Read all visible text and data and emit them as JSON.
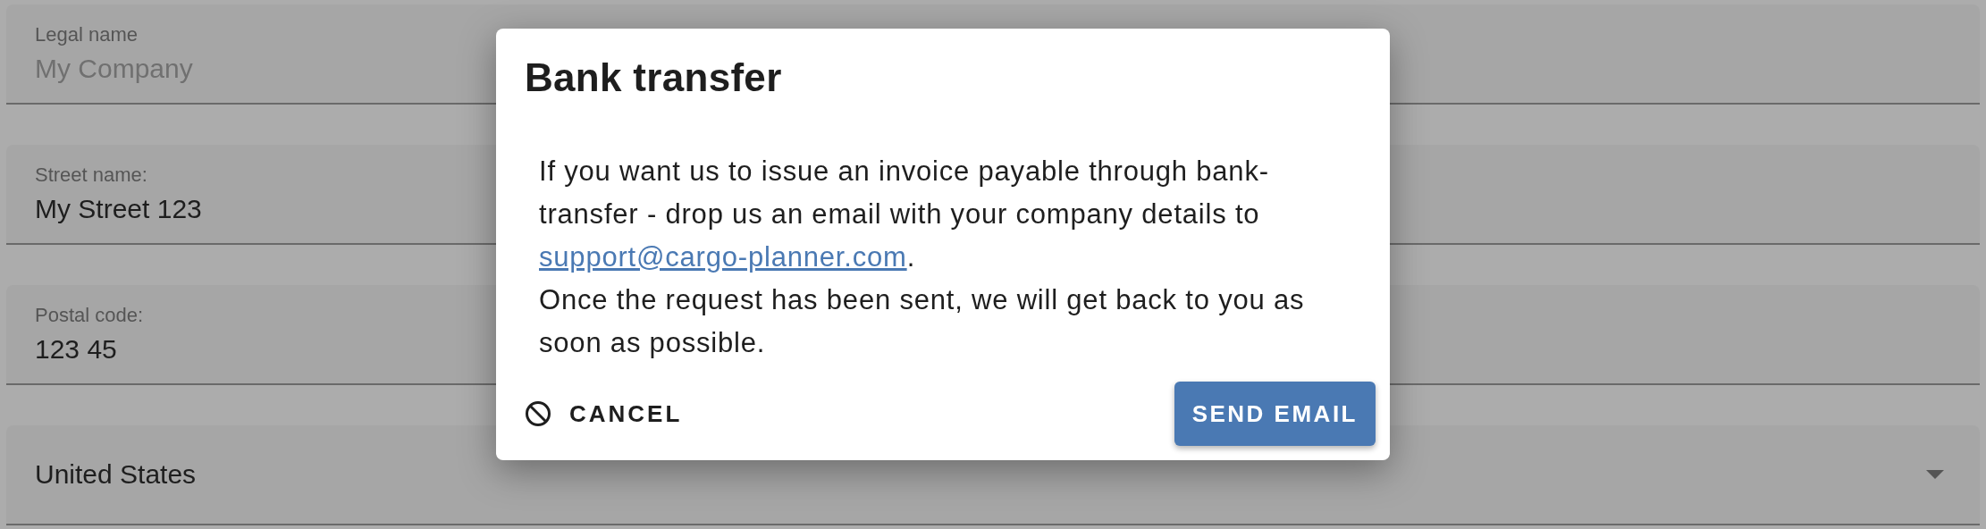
{
  "form": {
    "fields": [
      {
        "kind": "text",
        "label": "Legal name",
        "placeholder": "My Company"
      },
      {
        "kind": "text",
        "label": "Street name:",
        "value": "My Street 123"
      },
      {
        "kind": "text",
        "label": "Postal code:",
        "value": "123 45"
      },
      {
        "kind": "select",
        "value": "United States"
      }
    ]
  },
  "dialog": {
    "title": "Bank transfer",
    "text_before": "If you want us to issue an invoice payable through bank-transfer - drop us an email with your company details to ",
    "link": "support@cargo-planner.com",
    "text_after": ".",
    "text_second": "Once the request has been sent, we will get back to you as soon as possible.",
    "cancel_button": "CANCEL",
    "send_button": "SEND EMAIL"
  }
}
